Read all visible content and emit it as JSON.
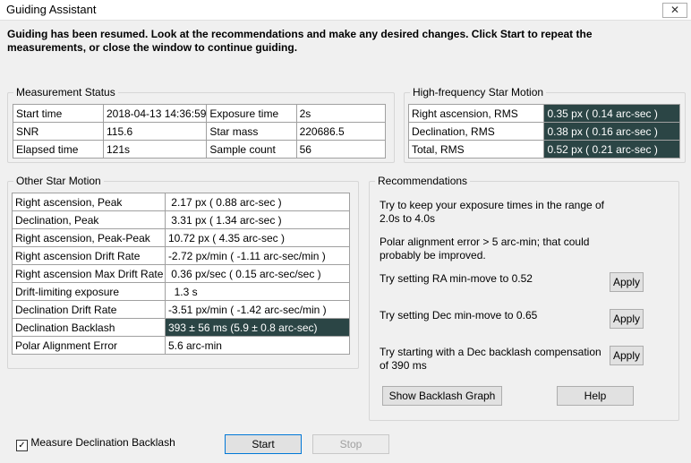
{
  "window": {
    "title": "Guiding Assistant",
    "close_glyph": "✕"
  },
  "instructions": "Guiding has been resumed. Look at the recommendations and make any desired changes.  Click Start to repeat the measurements, or close the window to continue guiding.",
  "measurement_status": {
    "title": "Measurement Status",
    "rows": [
      [
        "Start time",
        "2018-04-13 14:36:59",
        "Exposure time",
        "2s"
      ],
      [
        "SNR",
        "115.6",
        "Star mass",
        "220686.5"
      ],
      [
        "Elapsed time",
        "121s",
        "Sample count",
        "56"
      ]
    ]
  },
  "high_freq": {
    "title": "High-frequency Star Motion",
    "rows": [
      [
        "Right ascension, RMS",
        "0.35 px ( 0.14 arc-sec )"
      ],
      [
        "Declination, RMS",
        "0.38 px ( 0.16 arc-sec )"
      ],
      [
        "Total, RMS",
        "0.52 px ( 0.21 arc-sec )"
      ]
    ]
  },
  "other_motion": {
    "title": "Other Star Motion",
    "rows": [
      [
        "Right ascension, Peak",
        " 2.17 px ( 0.88 arc-sec )"
      ],
      [
        "Declination, Peak",
        " 3.31 px ( 1.34 arc-sec )"
      ],
      [
        "Right ascension, Peak-Peak",
        "10.72 px ( 4.35 arc-sec )"
      ],
      [
        "Right ascension Drift Rate",
        "-2.72 px/min ( -1.11 arc-sec/min )"
      ],
      [
        "Right ascension Max Drift Rate",
        " 0.36 px/sec ( 0.15 arc-sec/sec )"
      ],
      [
        "Drift-limiting exposure",
        "  1.3 s"
      ],
      [
        "Declination Drift Rate",
        "-3.51 px/min ( -1.42 arc-sec/min )"
      ],
      [
        "Declination Backlash",
        "393 ± 56 ms (5.9 ± 0.8 arc-sec)"
      ],
      [
        "Polar Alignment Error",
        "5.6 arc-min"
      ]
    ]
  },
  "recommendations": {
    "title": "Recommendations",
    "exposure": "Try to keep your exposure times in the range of 2.0s to 4.0s",
    "polar": "Polar alignment error > 5 arc-min; that could probably be improved.",
    "ra_minmove": "Try setting RA min-move to 0.52",
    "dec_minmove": "Try setting Dec min-move to 0.65",
    "backlash": "Try starting with a Dec backlash compensation of 390 ms",
    "apply_label": "Apply",
    "show_graph_label": "Show Backlash Graph",
    "help_label": "Help"
  },
  "footer": {
    "measure_backlash_label": "Measure Declination Backlash",
    "measure_backlash_checked": true,
    "start_label": "Start",
    "stop_label": "Stop"
  }
}
